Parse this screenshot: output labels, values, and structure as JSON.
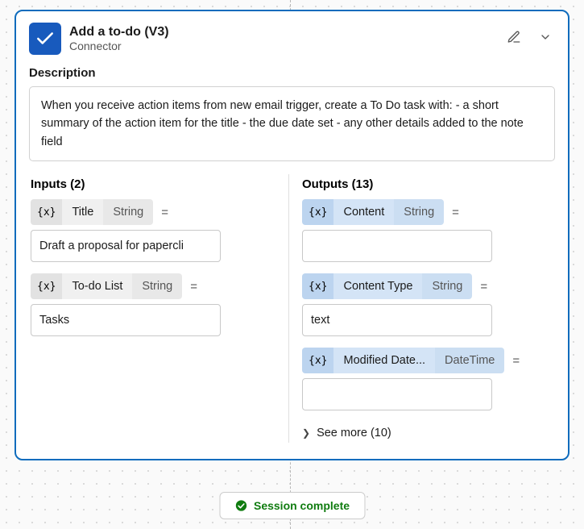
{
  "header": {
    "title": "Add a to-do (V3)",
    "subtitle": "Connector"
  },
  "description": {
    "label": "Description",
    "text": "When you receive action items from new email trigger, create a To Do task with: - a short summary of the action item for the title - the due date set - any other details added to the note field"
  },
  "inputs": {
    "heading": "Inputs (2)",
    "items": [
      {
        "fx": "{x}",
        "name": "Title",
        "type": "String",
        "value": "Draft a proposal for papercli"
      },
      {
        "fx": "{x}",
        "name": "To-do List",
        "type": "String",
        "value": "Tasks"
      }
    ]
  },
  "outputs": {
    "heading": "Outputs (13)",
    "items": [
      {
        "fx": "{x}",
        "name": "Content",
        "type": "String",
        "value": ""
      },
      {
        "fx": "{x}",
        "name": "Content Type",
        "type": "String",
        "value": "text"
      },
      {
        "fx": "{x}",
        "name": "Modified Date...",
        "type": "DateTime",
        "value": ""
      }
    ],
    "see_more": "See more (10)"
  },
  "symbols": {
    "equals": "="
  },
  "session": {
    "label": "Session complete"
  }
}
